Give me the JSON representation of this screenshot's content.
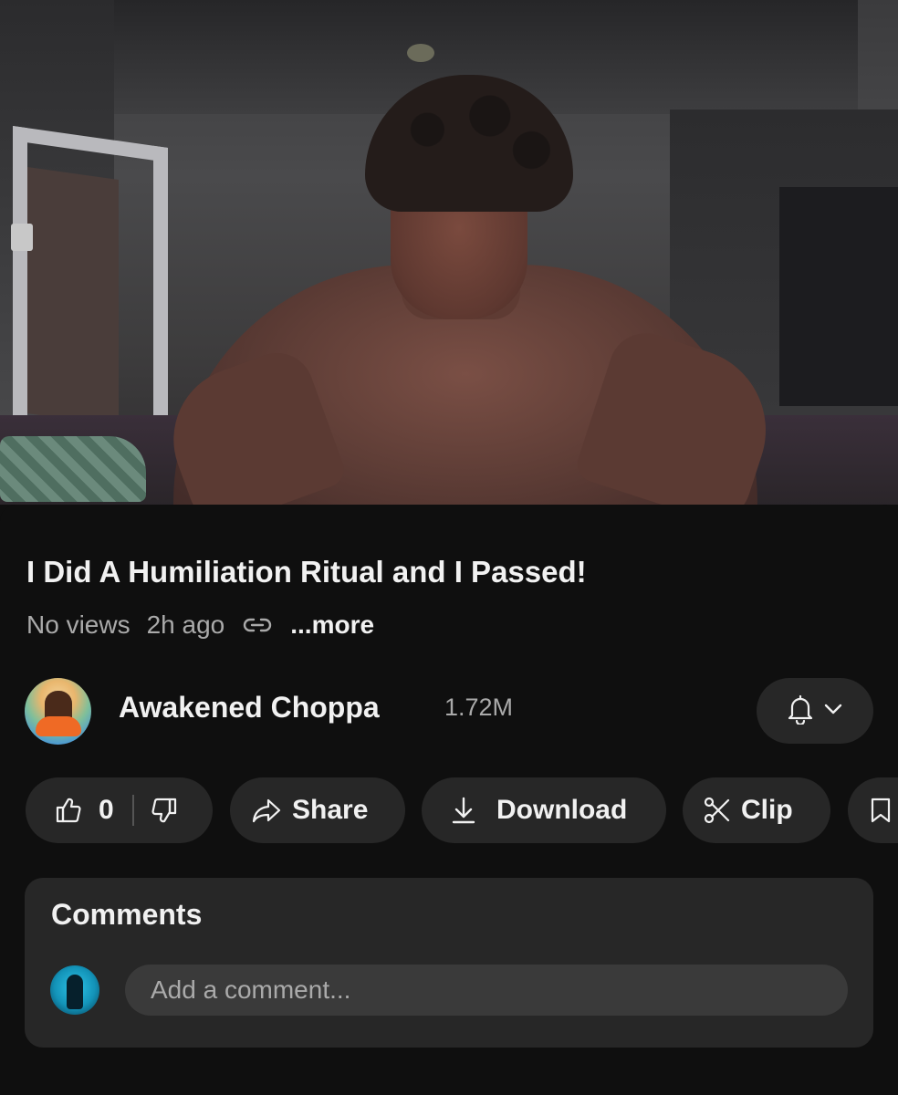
{
  "video": {
    "title": "I Did A Humiliation Ritual and I Passed!",
    "views": "No views",
    "age": "2h ago",
    "more_label": "...more"
  },
  "channel": {
    "name": "Awakened Choppa",
    "subscribers": "1.72M"
  },
  "actions": {
    "like_count": "0",
    "share_label": "Share",
    "download_label": "Download",
    "clip_label": "Clip"
  },
  "comments": {
    "title": "Comments",
    "placeholder": "Add a comment..."
  },
  "icons": {
    "link": "link-icon",
    "bell": "bell-icon",
    "chevron": "chevron-down-icon",
    "like": "thumbs-up-icon",
    "dislike": "thumbs-down-icon",
    "share": "share-arrow-icon",
    "download": "download-icon",
    "clip": "scissors-icon",
    "save": "bookmark-icon"
  },
  "colors": {
    "background": "#0f0f0f",
    "chip": "#272727",
    "text_primary": "#f1f1f1",
    "text_secondary": "#aaaaaa"
  }
}
